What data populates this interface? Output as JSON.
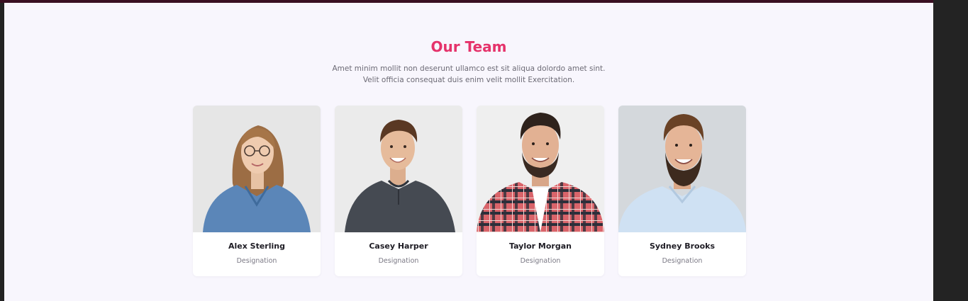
{
  "section": {
    "title": "Our Team",
    "description": "Amet minim mollit non deserunt ullamco est sit aliqua dolordo amet sint. Velit officia consequat duis enim velit mollit Exercitation."
  },
  "members": [
    {
      "name": "Alex Sterling",
      "role": "Designation"
    },
    {
      "name": "Casey Harper",
      "role": "Designation"
    },
    {
      "name": "Taylor Morgan",
      "role": "Designation"
    },
    {
      "name": "Sydney Brooks",
      "role": "Designation"
    }
  ],
  "colors": {
    "accent": "#e5336b",
    "page_background": "#f8f6fd",
    "frame_background": "#232323"
  }
}
